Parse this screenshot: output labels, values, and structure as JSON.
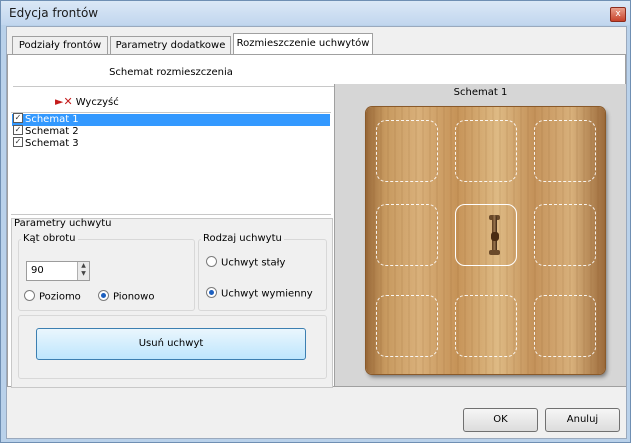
{
  "window": {
    "title": "Edycja frontów",
    "close_glyph": "x"
  },
  "tabs": [
    {
      "label": "Podziały frontów"
    },
    {
      "label": "Parametry dodatkowe"
    },
    {
      "label": "Rozmieszczenie uchwytów",
      "active": true
    }
  ],
  "section_title": "Schemat rozmieszczenia",
  "toolbar": {
    "clear_label": "Wyczyść",
    "clear_icon": "clear-x-icon"
  },
  "schemes": [
    {
      "label": "Schemat 1",
      "checked": true,
      "selected": true
    },
    {
      "label": "Schemat 2",
      "checked": true,
      "selected": false
    },
    {
      "label": "Schemat 3",
      "checked": true,
      "selected": false
    }
  ],
  "params": {
    "title": "Parametry uchwytu",
    "angle": {
      "title": "Kąt obrotu",
      "value": "90",
      "options": [
        {
          "label": "Poziomo",
          "checked": false
        },
        {
          "label": "Pionowo",
          "checked": true
        }
      ]
    },
    "type": {
      "title": "Rodzaj uchwytu",
      "options": [
        {
          "label": "Uchwyt stały",
          "checked": false
        },
        {
          "label": "Uchwyt wymienny",
          "checked": true
        }
      ]
    },
    "remove_label": "Usuń uchwyt"
  },
  "preview": {
    "title": "Schemat 1",
    "active_slot": 4,
    "handle_icon": "handle-icon"
  },
  "footer": {
    "ok_label": "OK",
    "cancel_label": "Anuluj"
  }
}
